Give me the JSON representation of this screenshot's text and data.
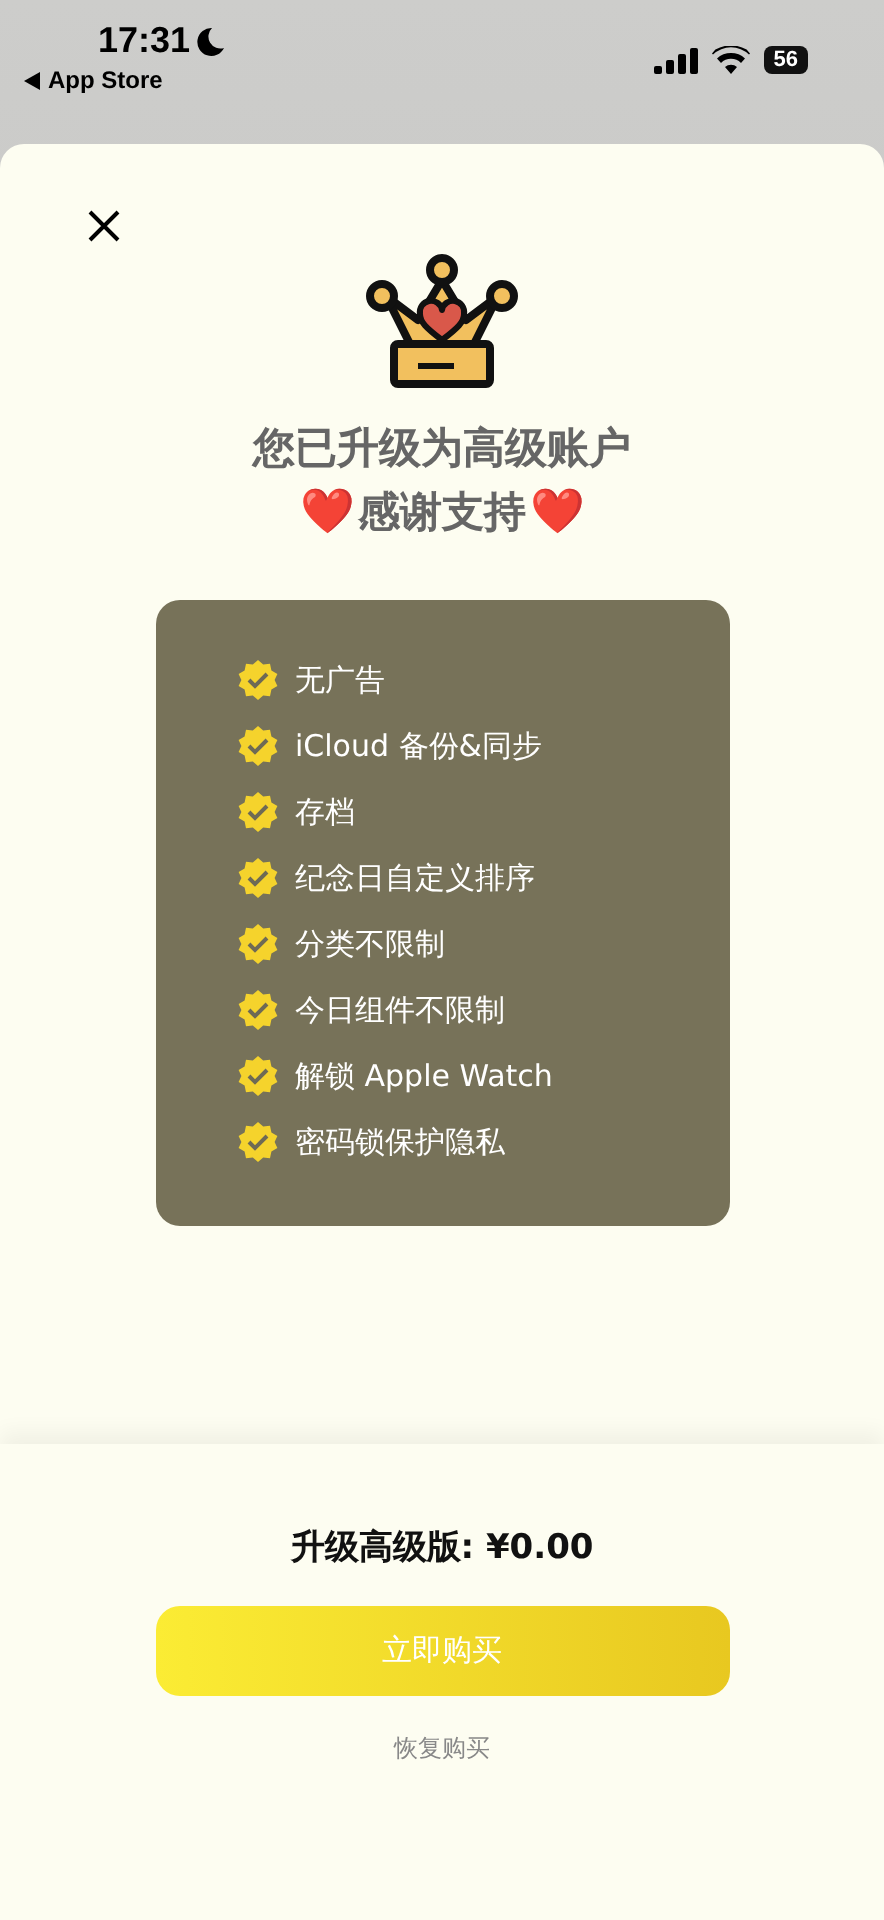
{
  "status_bar": {
    "time": "17:31",
    "back_label": "App Store",
    "battery": "56"
  },
  "title": {
    "line_1": "您已升级为高级账户",
    "heart_left": "❤️",
    "line_2": "感谢支持",
    "heart_right": "❤️"
  },
  "features": [
    {
      "label": "无广告"
    },
    {
      "label": "iCloud 备份&同步"
    },
    {
      "label": "存档"
    },
    {
      "label": "纪念日自定义排序"
    },
    {
      "label": "分类不限制"
    },
    {
      "label": "今日组件不限制"
    },
    {
      "label": "解锁 Apple Watch"
    },
    {
      "label": "密码锁保护隐私"
    }
  ],
  "price": "升级高级版: ¥0.00",
  "buy_button": "立即购买",
  "restore_link": "恢复购买"
}
